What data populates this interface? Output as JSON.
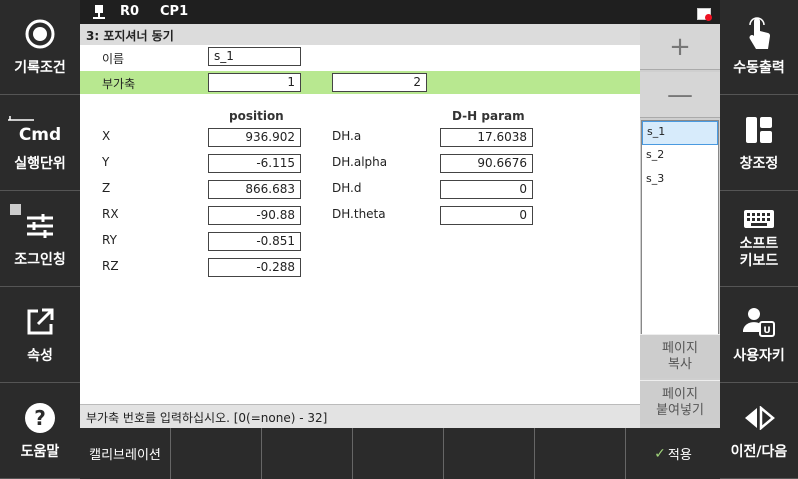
{
  "left_panel": [
    {
      "label": "기록조건",
      "icon": "record-circle-icon"
    },
    {
      "label": "실행단위",
      "badge": "Cmd",
      "icon": "cmd-icon"
    },
    {
      "label": "조그인칭",
      "icon": "sliders-icon"
    },
    {
      "label": "속성",
      "icon": "external-link-icon"
    },
    {
      "label": "도움말",
      "icon": "help-icon"
    }
  ],
  "right_panel": [
    {
      "label": "수동출력",
      "icon": "touch-hand-icon"
    },
    {
      "label": "창조정",
      "icon": "window-layout-icon"
    },
    {
      "label": "소프트\n키보드",
      "icon": "keyboard-icon"
    },
    {
      "label": "사용자키",
      "icon": "user-key-icon"
    },
    {
      "label": "이전/다음",
      "icon": "prev-next-icon"
    }
  ],
  "status": {
    "robot": "R0",
    "cp": "CP1"
  },
  "title": "3: 포지셔너 동기",
  "name_label": "이름",
  "name_value": "s_1",
  "aux_label": "부가축",
  "aux_value1": "1",
  "aux_value2": "2",
  "position_header": "position",
  "dh_header": "D-H param",
  "position": [
    {
      "label": "X",
      "value": "936.902"
    },
    {
      "label": "Y",
      "value": "-6.115"
    },
    {
      "label": "Z",
      "value": "866.683"
    },
    {
      "label": "RX",
      "value": "-90.88"
    },
    {
      "label": "RY",
      "value": "-0.851"
    },
    {
      "label": "RZ",
      "value": "-0.288"
    }
  ],
  "dh": [
    {
      "label": "DH.a",
      "value": "17.6038"
    },
    {
      "label": "DH.alpha",
      "value": "90.6676"
    },
    {
      "label": "DH.d",
      "value": "0"
    },
    {
      "label": "DH.theta",
      "value": "0"
    }
  ],
  "list": [
    "s_1",
    "s_2",
    "s_3"
  ],
  "plus": "+",
  "minus": "—",
  "page_copy": "페이지\n복사",
  "page_paste": "페이지\n붙여넣기",
  "message": "부가축 번호를 입력하십시오. [0(=none) - 32]",
  "bottom": {
    "calibration": "캘리브레이션",
    "apply": "적용"
  }
}
